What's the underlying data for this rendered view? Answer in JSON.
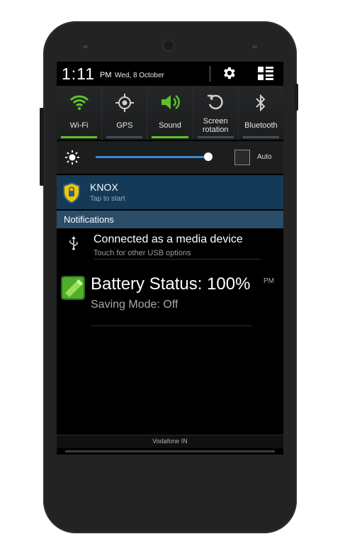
{
  "status_bar": {
    "time": "1:11",
    "ampm": "PM",
    "date": "Wed, 8 October",
    "settings_icon": "gear-icon",
    "menu_icon": "quick-settings-grid-icon"
  },
  "toggles": [
    {
      "label": "Wi-Fi",
      "icon": "wifi-icon",
      "active": true
    },
    {
      "label": "GPS",
      "icon": "gps-icon",
      "active": false
    },
    {
      "label": "Sound",
      "icon": "sound-icon",
      "active": true
    },
    {
      "label": "Screen rotation",
      "line1": "Screen",
      "line2": "rotation",
      "icon": "rotation-icon",
      "active": false
    },
    {
      "label": "Bluetooth",
      "icon": "bluetooth-icon",
      "active": false
    }
  ],
  "brightness": {
    "level": 0.92,
    "auto_label": "Auto",
    "auto_checked": false
  },
  "knox": {
    "title": "KNOX",
    "subtitle": "Tap to start"
  },
  "notifications": {
    "header": "Notifications",
    "usb": {
      "title": "Connected as a media device",
      "subtitle": "Touch for other USB options"
    },
    "battery": {
      "title": "Battery Status: 100%",
      "time": "PM",
      "subtitle": "Saving Mode: Off"
    }
  },
  "carrier": "Vodafone IN",
  "colors": {
    "active_green": "#5cc329",
    "knox_bg": "#143a57",
    "header_bg": "#2a4d69",
    "slider_blue": "#3a8bcf"
  }
}
